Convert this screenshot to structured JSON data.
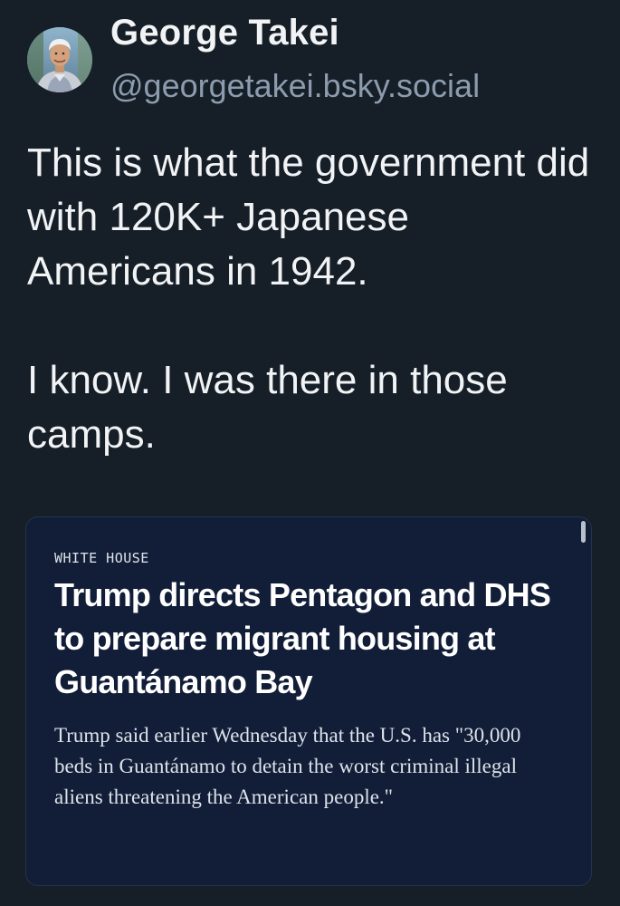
{
  "author": {
    "name": "George Takei",
    "handle": "@georgetakei.bsky.social",
    "avatar_icon": "profile-photo"
  },
  "post": {
    "paragraphs": [
      "This is what the government did with 120K+ Japanese Americans in 1942.",
      "I know. I was there in those camps."
    ]
  },
  "embed": {
    "kicker": "WHITE HOUSE",
    "headline": "Trump directs Pentagon and DHS to prepare migrant housing at Guantánamo Bay",
    "summary": "Trump said earlier Wednesday that the U.S. has \"30,000 beds in Guantánamo to detain the worst criminal illegal aliens threatening the American people.\""
  },
  "colors": {
    "background": "#161e27",
    "text": "#f1f3f5",
    "handle": "#8c9cae",
    "card_background": "#121e38",
    "card_border": "#26344a"
  }
}
